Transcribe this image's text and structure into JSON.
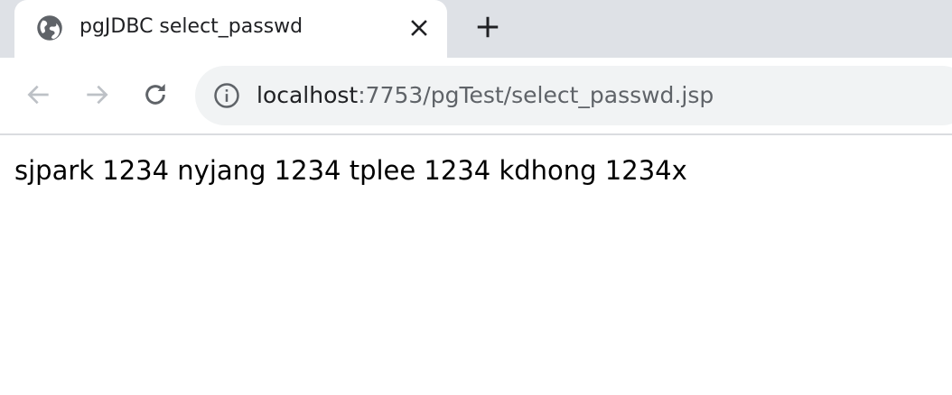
{
  "tab": {
    "title": "pgJDBC select_passwd",
    "favicon_icon": "globe-icon",
    "close_icon": "close-icon"
  },
  "new_tab_icon": "plus-icon",
  "toolbar": {
    "back_icon": "arrow-left-icon",
    "forward_icon": "arrow-right-icon",
    "reload_icon": "reload-icon"
  },
  "omnibox": {
    "info_icon": "info-icon",
    "url_host": "localhost",
    "url_rest": ":7753/pgTest/select_passwd.jsp"
  },
  "page": {
    "body_text": "sjpark 1234 nyjang 1234 tplee 1234 kdhong 1234x"
  },
  "colors": {
    "tabstrip_bg": "#dee1e6",
    "omnibox_bg": "#f1f3f4",
    "disabled_icon": "#bdc1c6",
    "active_icon": "#5f6368"
  }
}
